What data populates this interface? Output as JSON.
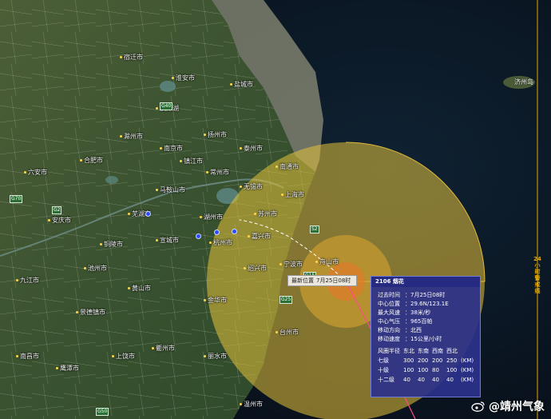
{
  "map": {
    "colors": {
      "land": "#3d5531",
      "sea": "#0c1a2a",
      "wind_zone": "#e6c23a",
      "storm_core": "#e8a030",
      "track": "#ffffff"
    },
    "cities": [
      {
        "name": "宿迁市"
      },
      {
        "name": "淮安市"
      },
      {
        "name": "盐城市"
      },
      {
        "name": "洪泽湖"
      },
      {
        "name": "滁州市"
      },
      {
        "name": "合肥市"
      },
      {
        "name": "南京市"
      },
      {
        "name": "扬州市"
      },
      {
        "name": "泰州市"
      },
      {
        "name": "南通市"
      },
      {
        "name": "常州市"
      },
      {
        "name": "无锡市"
      },
      {
        "name": "苏州市"
      },
      {
        "name": "上海市"
      },
      {
        "name": "湖州市"
      },
      {
        "name": "嘉兴市"
      },
      {
        "name": "杭州市"
      },
      {
        "name": "宁波市"
      },
      {
        "name": "绍兴市"
      },
      {
        "name": "舟山市"
      },
      {
        "name": "台州市"
      },
      {
        "name": "金华市"
      },
      {
        "name": "黄山市"
      },
      {
        "name": "宣城市"
      },
      {
        "name": "芜湖市"
      },
      {
        "name": "安庆市"
      },
      {
        "name": "六安市"
      },
      {
        "name": "铜陵市"
      },
      {
        "name": "景德镇市"
      },
      {
        "name": "上饶市"
      },
      {
        "name": "衢州市"
      },
      {
        "name": "丽水市"
      },
      {
        "name": "温州市"
      },
      {
        "name": "鹰潭市"
      },
      {
        "name": "南昌市"
      },
      {
        "name": "九江市"
      },
      {
        "name": "池州市"
      },
      {
        "name": "马鞍山市"
      },
      {
        "name": "镇江市"
      },
      {
        "name": "济州岛"
      }
    ],
    "highways": [
      "G40",
      "G2",
      "G15",
      "G60",
      "G92",
      "G25",
      "G3",
      "S2",
      "G70",
      "G50"
    ],
    "vessel_label": "24小时警戒线"
  },
  "typhoon": {
    "position_label": "最新位置",
    "position_time": "7月25日08时",
    "info_title": "2106 烟花",
    "info_rows": [
      {
        "key": "过去时间",
        "value": "7月25日08时"
      },
      {
        "key": "中心位置",
        "value": "29.6N/123.1E"
      },
      {
        "key": "最大风速",
        "value": "38米/秒"
      },
      {
        "key": "中心气压",
        "value": "965百帕"
      },
      {
        "key": "移动方向",
        "value": "北西"
      },
      {
        "key": "移动速度",
        "value": "15公里/小时"
      }
    ],
    "radius_header": [
      "风圈半径",
      "东北",
      "东南",
      "西南",
      "西北"
    ],
    "radius_rows": [
      {
        "level": "七级",
        "ne": "300",
        "se": "200",
        "sw": "200",
        "nw": "250",
        "unit": "(KM)"
      },
      {
        "level": "十级",
        "ne": "100",
        "se": "100",
        "sw": "80",
        "nw": "100",
        "unit": "(KM)"
      },
      {
        "level": "十二级",
        "ne": "40",
        "se": "40",
        "sw": "40",
        "nw": "40",
        "unit": "(KM)"
      }
    ]
  },
  "watermark": {
    "text": "@靖州气象",
    "icon": "weibo-icon"
  }
}
